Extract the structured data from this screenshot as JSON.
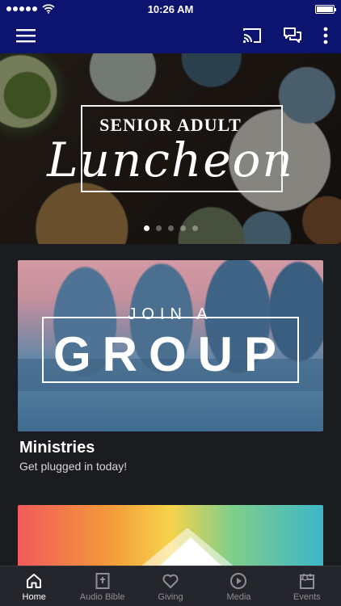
{
  "status_bar": {
    "time": "10:26 AM"
  },
  "nav": {
    "menu_icon": "hamburger-icon",
    "cast_icon": "cast-icon",
    "chat_icon": "chat-bubbles-icon",
    "more_icon": "more-vertical-icon"
  },
  "hero": {
    "kicker": "SENIOR ADULT",
    "script_title": "Luncheon",
    "pager": {
      "count": 5,
      "active_index": 0
    }
  },
  "cards": [
    {
      "image_kicker": "JOIN A",
      "image_title": "GROUP",
      "title": "Ministries",
      "subtitle": "Get plugged in today!"
    }
  ],
  "tabs": [
    {
      "label": "Home",
      "icon": "home-icon",
      "active": true
    },
    {
      "label": "Audio Bible",
      "icon": "bible-icon",
      "active": false
    },
    {
      "label": "Giving",
      "icon": "heart-icon",
      "active": false
    },
    {
      "label": "Media",
      "icon": "play-circle-icon",
      "active": false
    },
    {
      "label": "Events",
      "icon": "calendar-icon",
      "active": false
    }
  ],
  "colors": {
    "header": "#0d1470",
    "background": "#1b1c20",
    "tabbar": "#25262b",
    "tab_inactive": "#8e8f95",
    "tab_active": "#ffffff"
  }
}
